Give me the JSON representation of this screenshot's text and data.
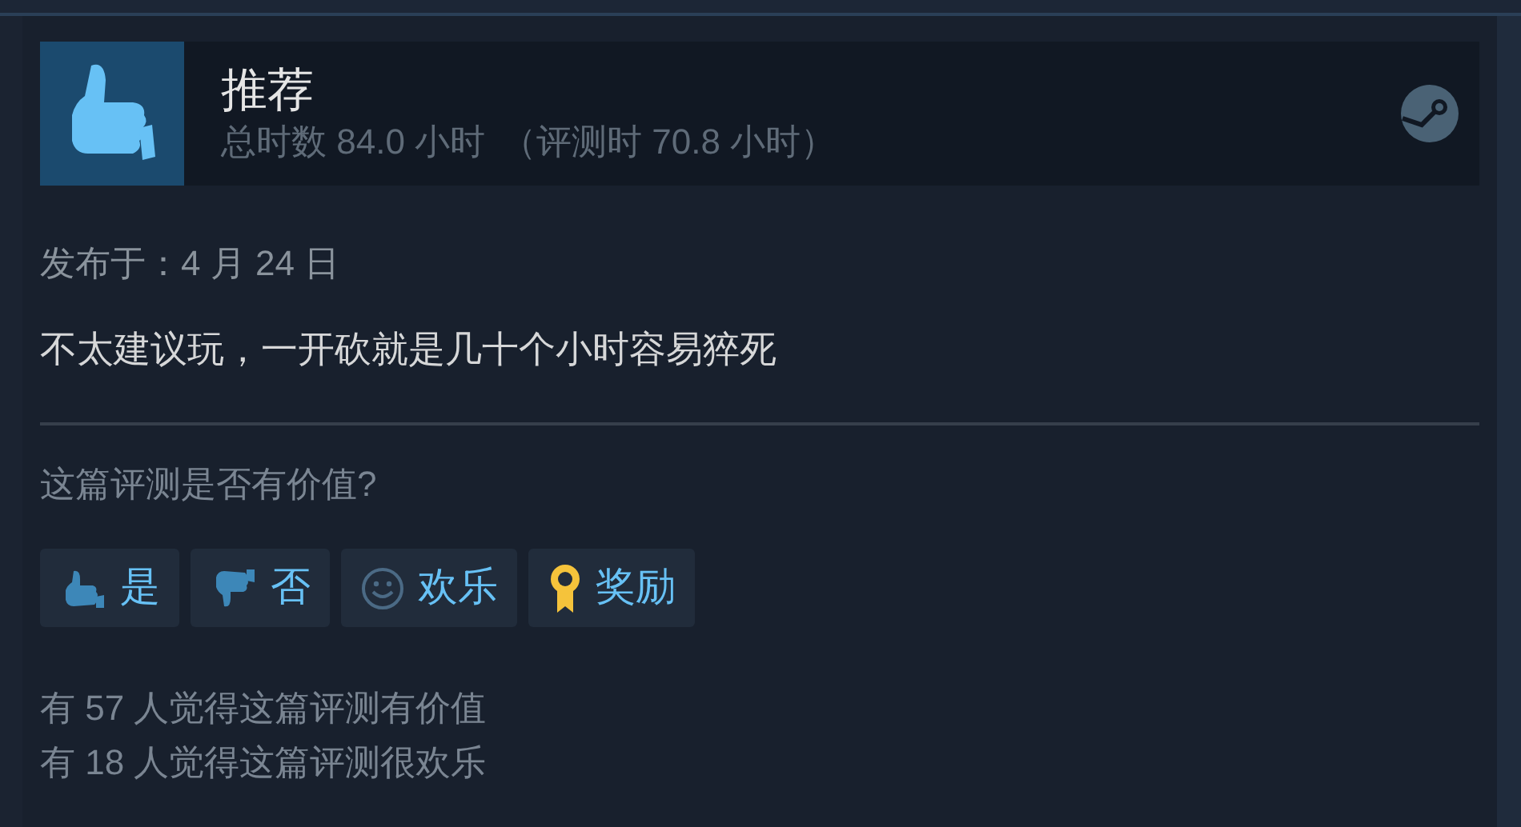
{
  "review": {
    "verdict": "推荐",
    "hours": "总时数 84.0 小时",
    "hours_at_review": "（评测时 70.8 小时）",
    "posted": "发布于：4 月 24 日",
    "text": "不太建议玩，一开砍就是几十个小时容易猝死"
  },
  "helpful": {
    "question": "这篇评测是否有价值?",
    "buttons": [
      {
        "kind": "yes",
        "label": "是"
      },
      {
        "kind": "no",
        "label": "否"
      },
      {
        "kind": "funny",
        "label": "欢乐"
      },
      {
        "kind": "award",
        "label": "奖励"
      }
    ],
    "stats": [
      "有 57 人觉得这篇评测有价值",
      "有 18 人觉得这篇评测很欢乐"
    ]
  }
}
